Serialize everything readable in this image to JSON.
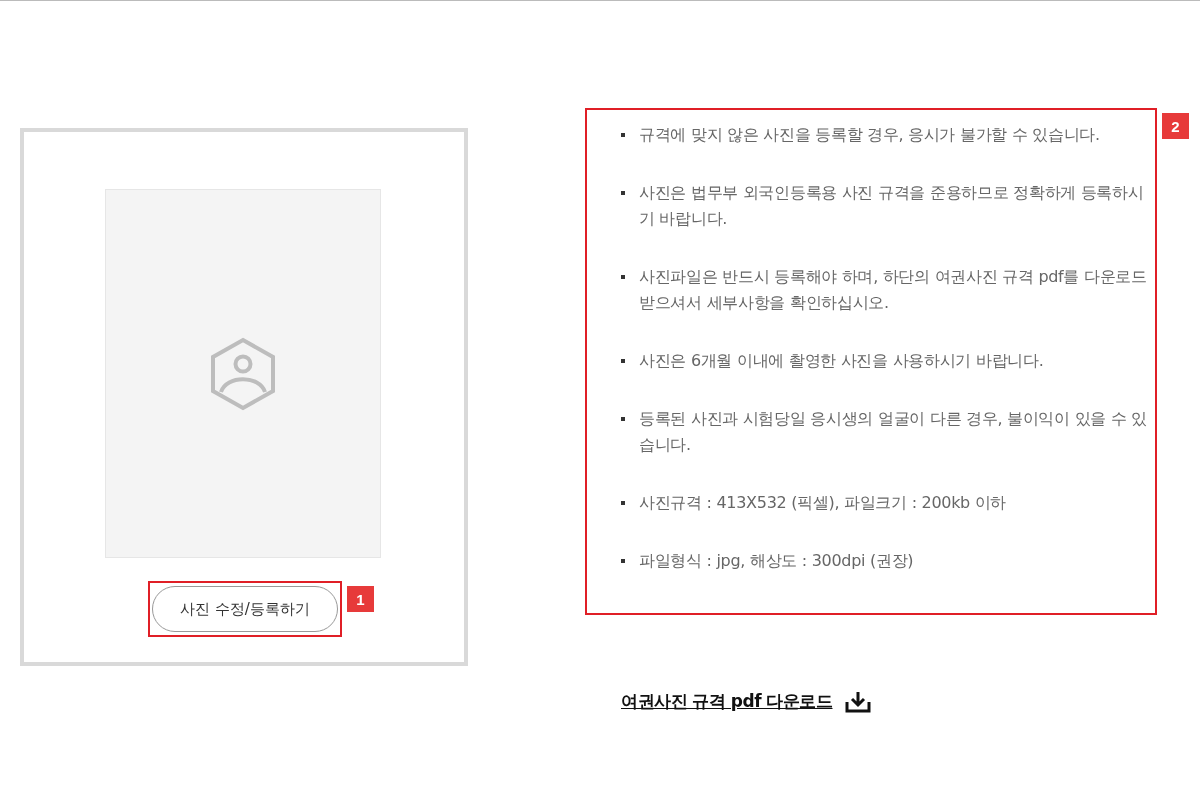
{
  "photo_panel": {
    "button": {
      "label": "사진 수정/등록하기"
    },
    "annotation": {
      "number": "1"
    }
  },
  "guide": {
    "annotation": {
      "number": "2"
    },
    "items": [
      "규격에 맞지 않은 사진을 등록할 경우, 응시가 불가할 수 있습니다.",
      "사진은 법무부 외국인등록용 사진 규격을 준용하므로 정확하게 등록하시기 바랍니다.",
      "사진파일은 반드시 등록해야 하며, 하단의 여권사진 규격 pdf를 다운로드 받으셔서 세부사항을 확인하십시오.",
      "사진은 6개월 이내에 촬영한 사진을 사용하시기 바랍니다.",
      "등록된 사진과 시험당일 응시생의 얼굴이 다른 경우, 불이익이 있을 수 있습니다.",
      "사진규격 : 413X532 (픽셀), 파일크기 : 200kb 이하",
      "파일형식 : jpg, 해상도 : 300dpi (권장)"
    ]
  },
  "download_link": {
    "label": "여권사진 규격 pdf 다운로드"
  }
}
